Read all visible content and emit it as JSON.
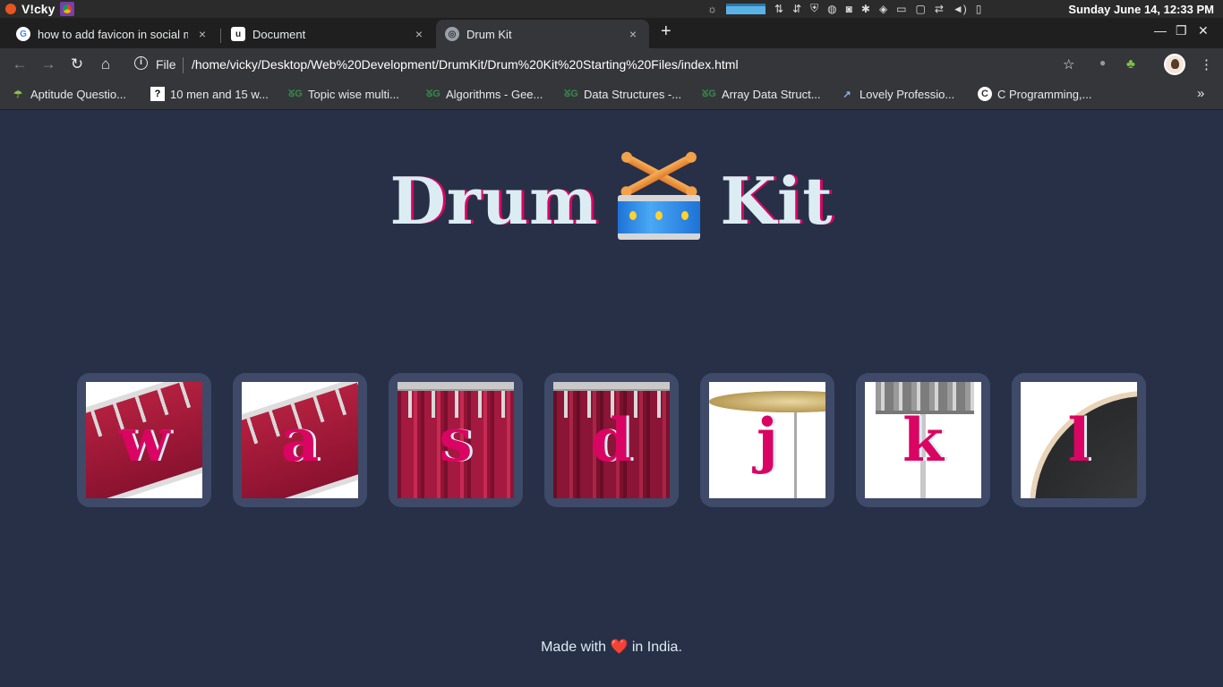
{
  "system": {
    "username": "V!cky",
    "datetime": "Sunday June 14, 12:33 PM"
  },
  "tabs": [
    {
      "title": "how to add favicon in social m",
      "close": "×"
    },
    {
      "title": "Document",
      "close": "×"
    },
    {
      "title": "Drum Kit",
      "close": "×"
    }
  ],
  "toolbar": {
    "file_label": "File",
    "url": "/home/vicky/Desktop/Web%20Development/DrumKit/Drum%20Kit%20Starting%20Files/index.html"
  },
  "bookmarks": [
    {
      "label": "Aptitude Questio..."
    },
    {
      "label": "10 men and 15 w..."
    },
    {
      "label": "Topic wise multi..."
    },
    {
      "label": "Algorithms - Gee..."
    },
    {
      "label": "Data Structures -..."
    },
    {
      "label": "Array Data Struct..."
    },
    {
      "label": "Lovely Professio..."
    },
    {
      "label": "C Programming,..."
    }
  ],
  "page": {
    "title_left": "Drum",
    "title_right": "Kit",
    "drums": [
      {
        "key": "w"
      },
      {
        "key": "a"
      },
      {
        "key": "s"
      },
      {
        "key": "d"
      },
      {
        "key": "j"
      },
      {
        "key": "k"
      },
      {
        "key": "l"
      }
    ],
    "footer_before": "Made with",
    "footer_heart": "❤️",
    "footer_after": "in India."
  },
  "colors": {
    "background": "#283048",
    "title_text": "#dbedf3",
    "accent": "#da0463",
    "button_frame": "#3e4a68"
  }
}
